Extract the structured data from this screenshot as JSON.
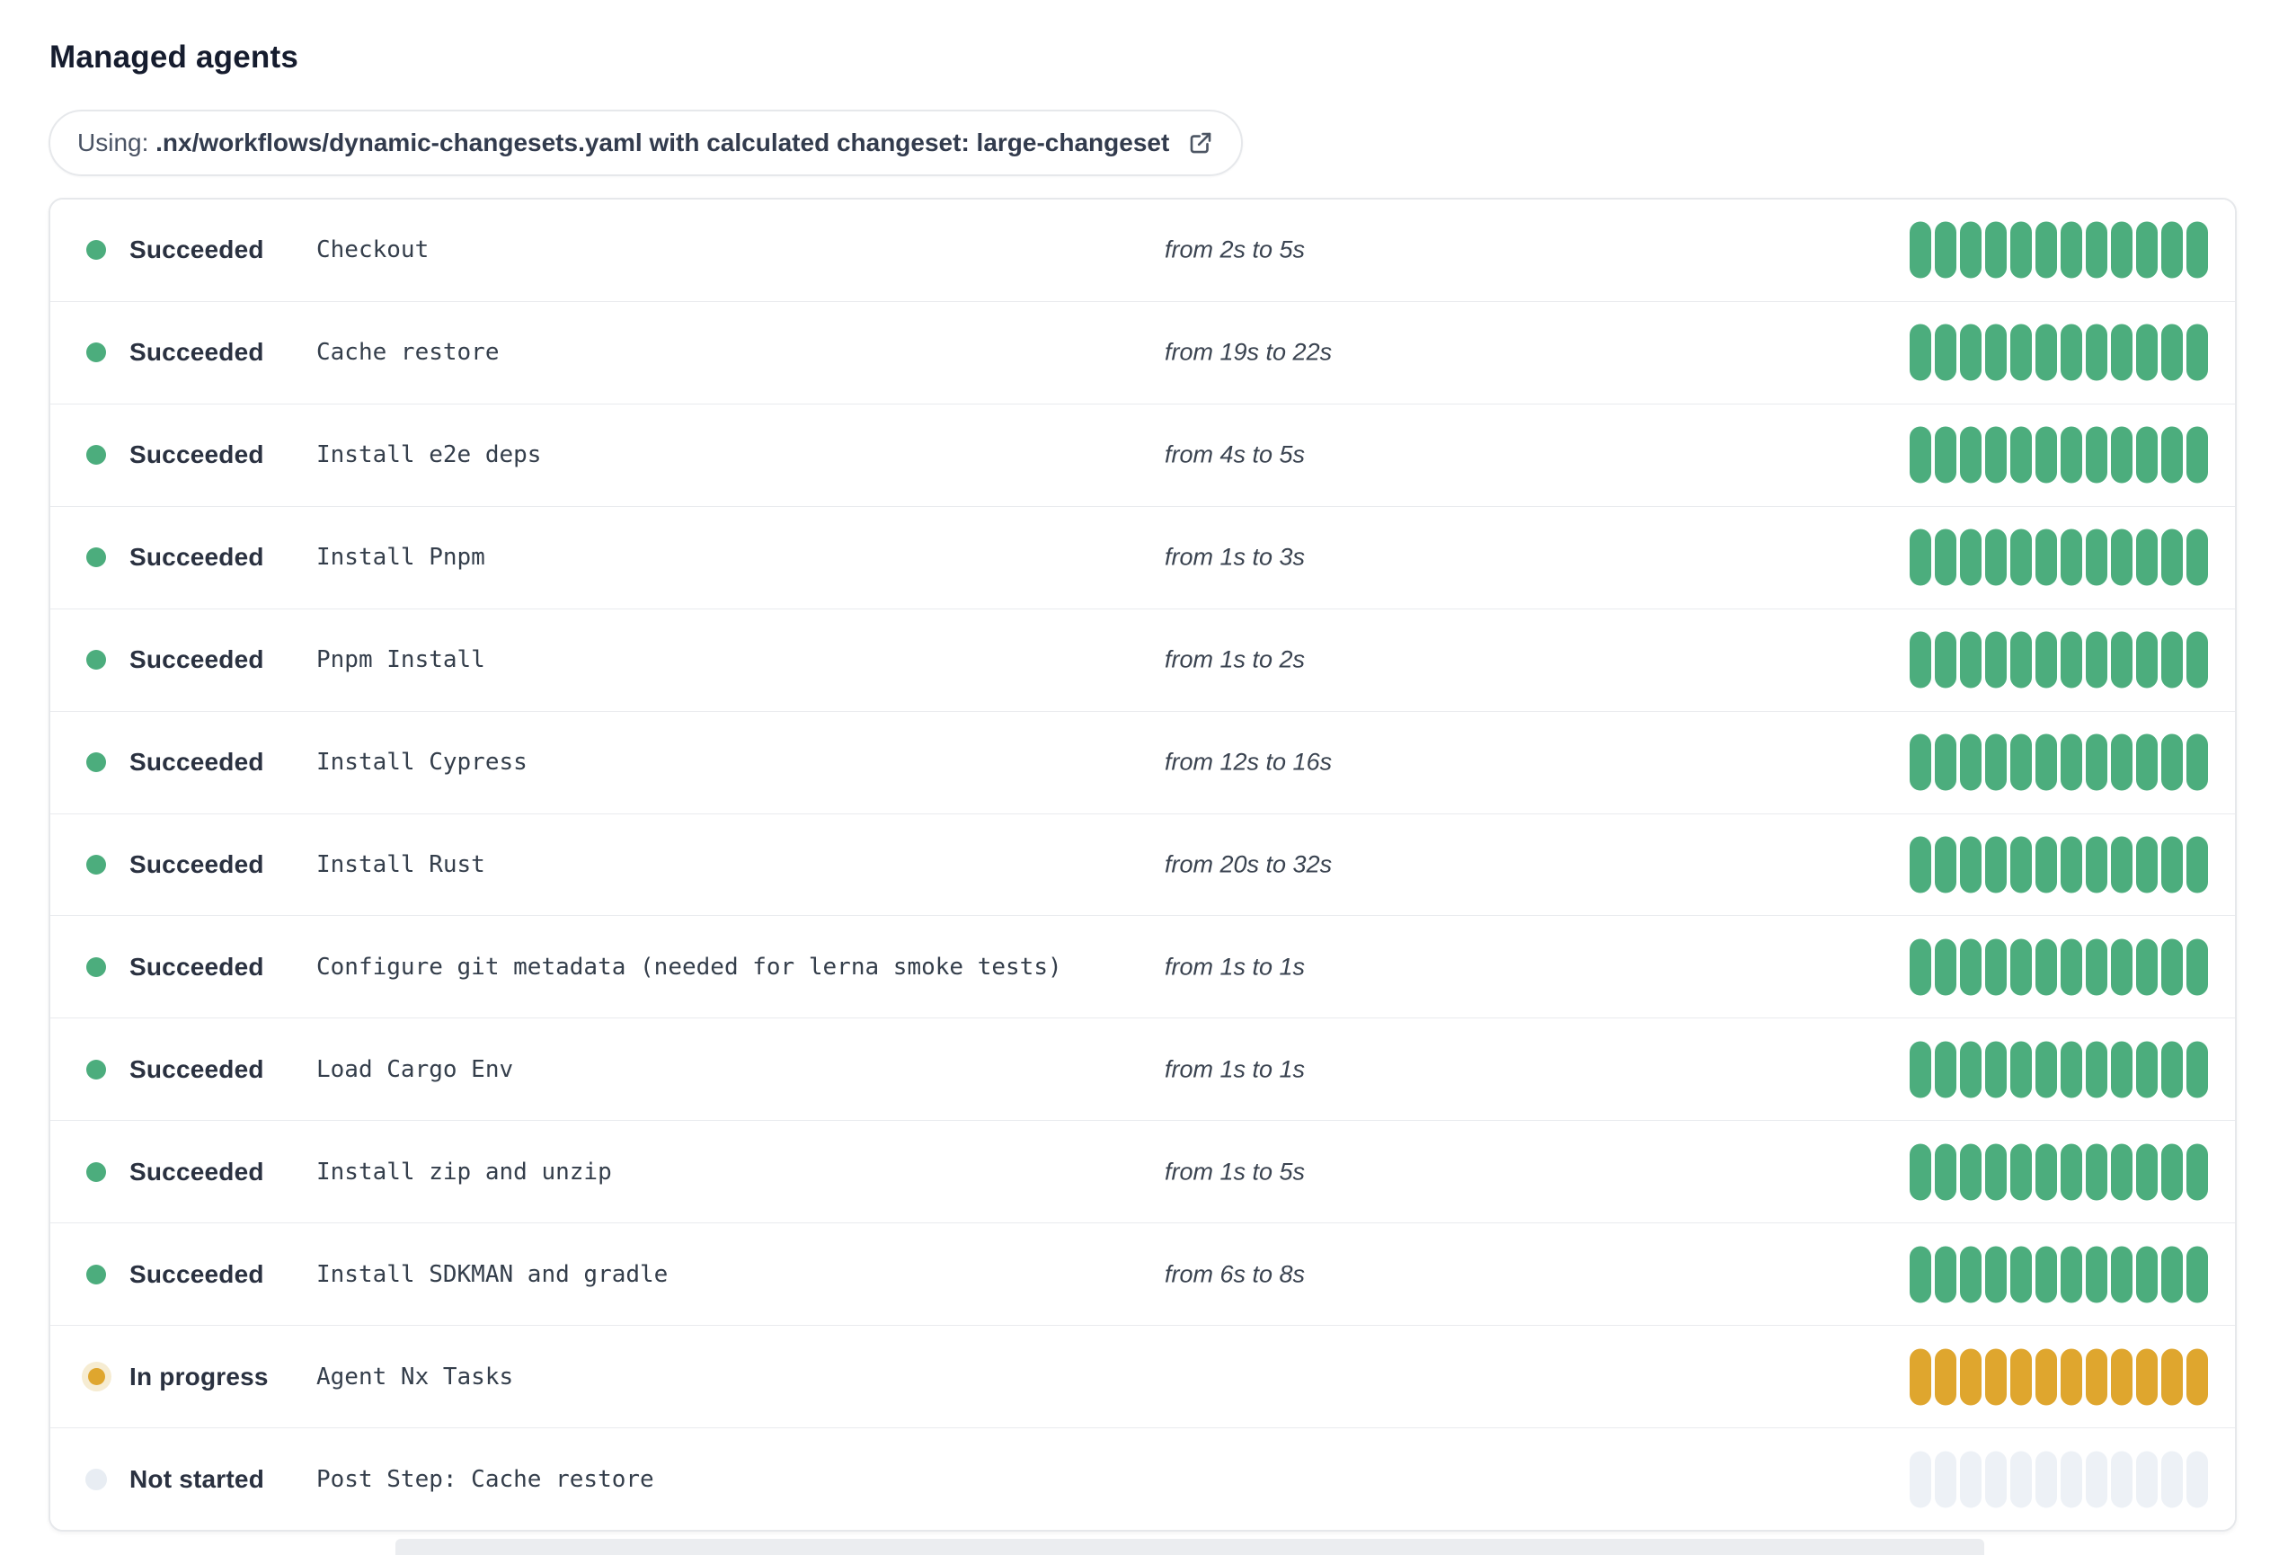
{
  "page": {
    "title": "Managed agents"
  },
  "workflow_banner": {
    "prefix": "Using: ",
    "path_text": ".nx/workflows/dynamic-changesets.yaml with calculated changeset: large-changeset",
    "icon": "external-link-icon"
  },
  "colors": {
    "succeeded": "#4CAD7D",
    "in_progress": "#DFA62E",
    "in_progress_halo": "#F6ECD2",
    "not_started_segment": "#EDF1F6",
    "not_started_dot": "#E8EDF3",
    "card_border": "#E6E8EB",
    "row_separator": "#E9EBEE",
    "text_dark": "#2A3140"
  },
  "agents": {
    "segments_per_row": 12,
    "rows": [
      {
        "status": "Succeeded",
        "status_key": "succeeded",
        "step": "Checkout",
        "duration": "from 2s to 5s"
      },
      {
        "status": "Succeeded",
        "status_key": "succeeded",
        "step": "Cache restore",
        "duration": "from 19s to 22s"
      },
      {
        "status": "Succeeded",
        "status_key": "succeeded",
        "step": "Install e2e deps",
        "duration": "from 4s to 5s"
      },
      {
        "status": "Succeeded",
        "status_key": "succeeded",
        "step": "Install Pnpm",
        "duration": "from 1s to 3s"
      },
      {
        "status": "Succeeded",
        "status_key": "succeeded",
        "step": "Pnpm Install",
        "duration": "from 1s to 2s"
      },
      {
        "status": "Succeeded",
        "status_key": "succeeded",
        "step": "Install Cypress",
        "duration": "from 12s to 16s"
      },
      {
        "status": "Succeeded",
        "status_key": "succeeded",
        "step": "Install Rust",
        "duration": "from 20s to 32s"
      },
      {
        "status": "Succeeded",
        "status_key": "succeeded",
        "step": "Configure git metadata (needed for lerna smoke tests)",
        "duration": "from 1s to 1s"
      },
      {
        "status": "Succeeded",
        "status_key": "succeeded",
        "step": "Load Cargo Env",
        "duration": "from 1s to 1s"
      },
      {
        "status": "Succeeded",
        "status_key": "succeeded",
        "step": "Install zip and unzip",
        "duration": "from 1s to 5s"
      },
      {
        "status": "Succeeded",
        "status_key": "succeeded",
        "step": "Install SDKMAN and gradle",
        "duration": "from 6s to 8s"
      },
      {
        "status": "In progress",
        "status_key": "in_progress",
        "step": "Agent Nx Tasks",
        "duration": ""
      },
      {
        "status": "Not started",
        "status_key": "not_started",
        "step": "Post Step: Cache restore",
        "duration": ""
      }
    ]
  }
}
